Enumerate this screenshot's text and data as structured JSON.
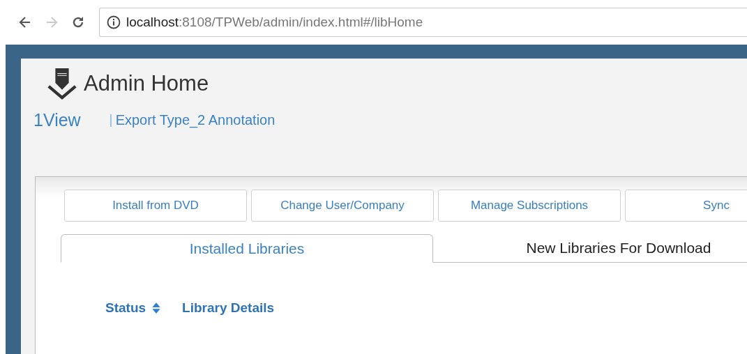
{
  "browser": {
    "url_host": "localhost",
    "url_path": ":8108/TPWeb/admin/index.html#/libHome"
  },
  "page": {
    "title": "Admin Home",
    "links": [
      {
        "kind": "link",
        "label": "1View"
      },
      {
        "kind": "separator"
      },
      {
        "kind": "link",
        "label": "Export Type_2 Annotation"
      }
    ]
  },
  "actions": [
    "Install from DVD",
    "Change User/Company",
    "Manage Subscriptions",
    "Sync"
  ],
  "tabs": [
    {
      "label": "Installed Libraries",
      "selected": true
    },
    {
      "label": "New Libraries For Download",
      "selected": false
    }
  ],
  "table": {
    "columns": [
      {
        "label": "Status",
        "kind": "sortable"
      },
      {
        "label": "Library Details",
        "kind": "plain"
      }
    ]
  }
}
